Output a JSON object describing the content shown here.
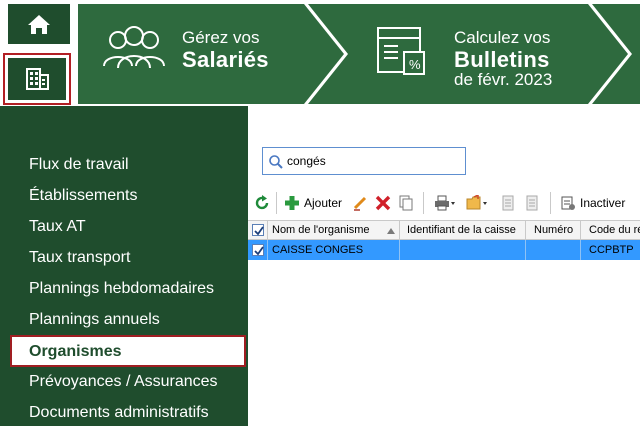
{
  "banner": {
    "salaries": {
      "line1": "Gérez vos",
      "line2": "Salariés"
    },
    "bulletins": {
      "line1": "Calculez vos",
      "line2": "Bulletins",
      "line3": "de févr. 2023"
    }
  },
  "sidebar": {
    "items": [
      {
        "label": "Flux de travail"
      },
      {
        "label": "Établissements"
      },
      {
        "label": "Taux AT"
      },
      {
        "label": "Taux transport"
      },
      {
        "label": "Plannings hebdomadaires"
      },
      {
        "label": "Plannings annuels"
      },
      {
        "label": "Organismes",
        "selected": true
      },
      {
        "label": "Prévoyances / Assurances"
      },
      {
        "label": "Documents administratifs"
      }
    ]
  },
  "search": {
    "value": "congés"
  },
  "toolbar": {
    "add_label": "Ajouter",
    "inactive_label": "Inactiver"
  },
  "table": {
    "columns": [
      "Nom de l'organisme",
      "Identifiant de la caisse",
      "Numéro",
      "Code du ré"
    ],
    "rows": [
      {
        "checked": true,
        "cells": [
          "CAISSE CONGES",
          "",
          "",
          "CCPBTP"
        ]
      }
    ]
  },
  "colors": {
    "brand_green": "#1f4d2d",
    "accent_red": "#b21f24",
    "selection_blue": "#3399ff"
  }
}
